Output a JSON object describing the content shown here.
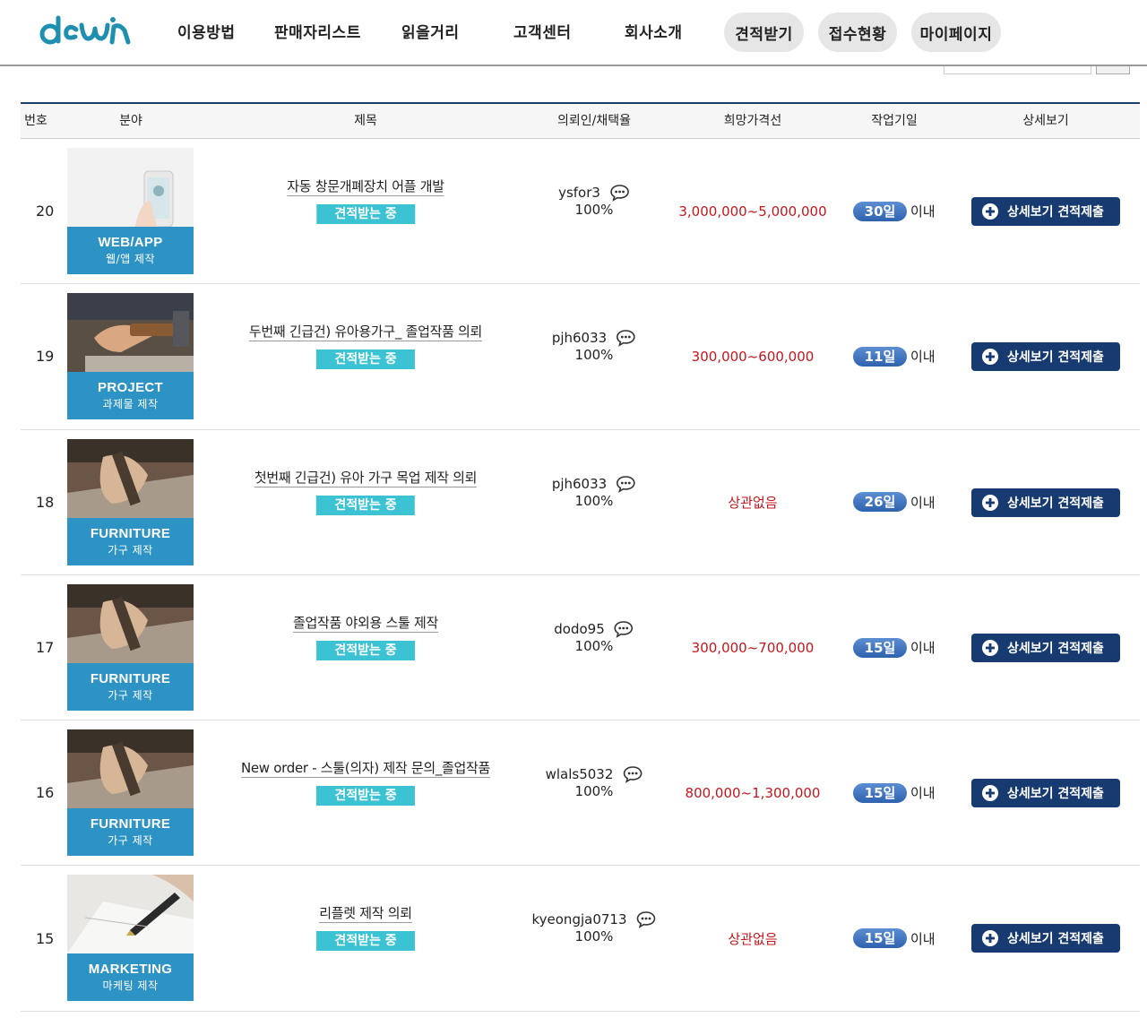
{
  "header": {
    "logo_text": "dewin",
    "nav": [
      "이용방법",
      "판매자리스트",
      "읽을거리",
      "고객센터",
      "회사소개"
    ],
    "pills": [
      "견적받기",
      "접수현황",
      "마이페이지"
    ]
  },
  "table": {
    "headers": [
      "번호",
      "분야",
      "제목",
      "의뢰인/채택율",
      "희망가격선",
      "작업기일",
      "상세보기"
    ],
    "detail_label": "상세보기 견적제출",
    "days_suffix": "이내",
    "rows": [
      {
        "num": "20",
        "cat_en": "WEB/APP",
        "cat_ko": "웹/앱 제작",
        "photo": "phone",
        "title": "자동 창문개폐장치 어플 개발",
        "status": "견적받는 중",
        "requester": "ysfor3",
        "rate": "100%",
        "price": "3,000,000~5,000,000",
        "days": "30일"
      },
      {
        "num": "19",
        "cat_en": "PROJECT",
        "cat_ko": "과제물 제작",
        "photo": "hammer",
        "title": "두번째 긴급건) 유아용가구_ 졸업작품 의뢰",
        "status": "견적받는 중",
        "requester": "pjh6033",
        "rate": "100%",
        "price": "300,000~600,000",
        "days": "11일"
      },
      {
        "num": "18",
        "cat_en": "FURNITURE",
        "cat_ko": "가구 제작",
        "photo": "wood",
        "title": "첫번째 긴급건) 유아 가구 목업 제작 의뢰",
        "status": "견적받는 중",
        "requester": "pjh6033",
        "rate": "100%",
        "price": "상관없음",
        "days": "26일"
      },
      {
        "num": "17",
        "cat_en": "FURNITURE",
        "cat_ko": "가구 제작",
        "photo": "wood",
        "title": "졸업작품 야외용 스툴 제작",
        "status": "견적받는 중",
        "requester": "dodo95",
        "rate": "100%",
        "price": "300,000~700,000",
        "days": "15일"
      },
      {
        "num": "16",
        "cat_en": "FURNITURE",
        "cat_ko": "가구 제작",
        "photo": "wood",
        "title": "New order - 스툴(의자) 제작 문의_졸업작품",
        "status": "견적받는 중",
        "requester": "wlals5032",
        "rate": "100%",
        "price": "800,000~1,300,000",
        "days": "15일"
      },
      {
        "num": "15",
        "cat_en": "MARKETING",
        "cat_ko": "마케팅 제작",
        "photo": "pen",
        "title": "리플렛 제작 의뢰",
        "status": "견적받는 중",
        "requester": "kyeongja0713",
        "rate": "100%",
        "price": "상관없음",
        "days": "15일"
      }
    ]
  },
  "colors": {
    "accent_navy": "#173a70",
    "status_teal": "#3cc3d3",
    "price_red": "#c4161c",
    "category_blue": "#2d92c4",
    "logo_teal": "#1f8fb0"
  }
}
